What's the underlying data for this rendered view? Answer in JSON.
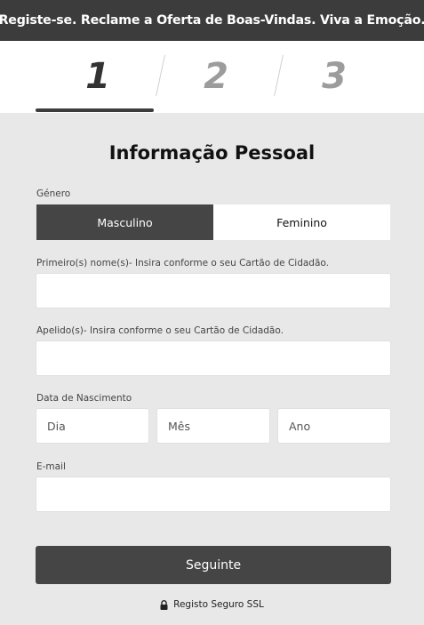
{
  "banner": {
    "text": "Registe-se. Reclame a Oferta de Boas-Vindas. Viva a Emoção."
  },
  "steps": [
    {
      "number": "1",
      "active": true
    },
    {
      "number": "2",
      "active": false
    },
    {
      "number": "3",
      "active": false
    }
  ],
  "form": {
    "title": "Informação Pessoal",
    "gender": {
      "label": "Género",
      "options": [
        "Masculino",
        "Feminino"
      ],
      "selected": "Masculino"
    },
    "first_name": {
      "label": "Primeiro(s) nome(s)- Insira conforme o seu Cartão de Cidadão.",
      "value": ""
    },
    "surname": {
      "label": "Apelido(s)- Insira conforme o seu Cartão de Cidadão.",
      "value": ""
    },
    "birth_date": {
      "label": "Data de Nascimento",
      "day_placeholder": "Dia",
      "month_placeholder": "Mês",
      "year_placeholder": "Ano"
    },
    "email": {
      "label": "E-mail",
      "value": ""
    },
    "next_label": "Seguinte",
    "ssl_text": "Registo Seguro SSL"
  },
  "icons": {
    "ssl": "lock-icon"
  },
  "colors": {
    "dark": "#3c3c3c",
    "background": "#e8e8e8",
    "inactive_step": "#9c9c9c"
  }
}
